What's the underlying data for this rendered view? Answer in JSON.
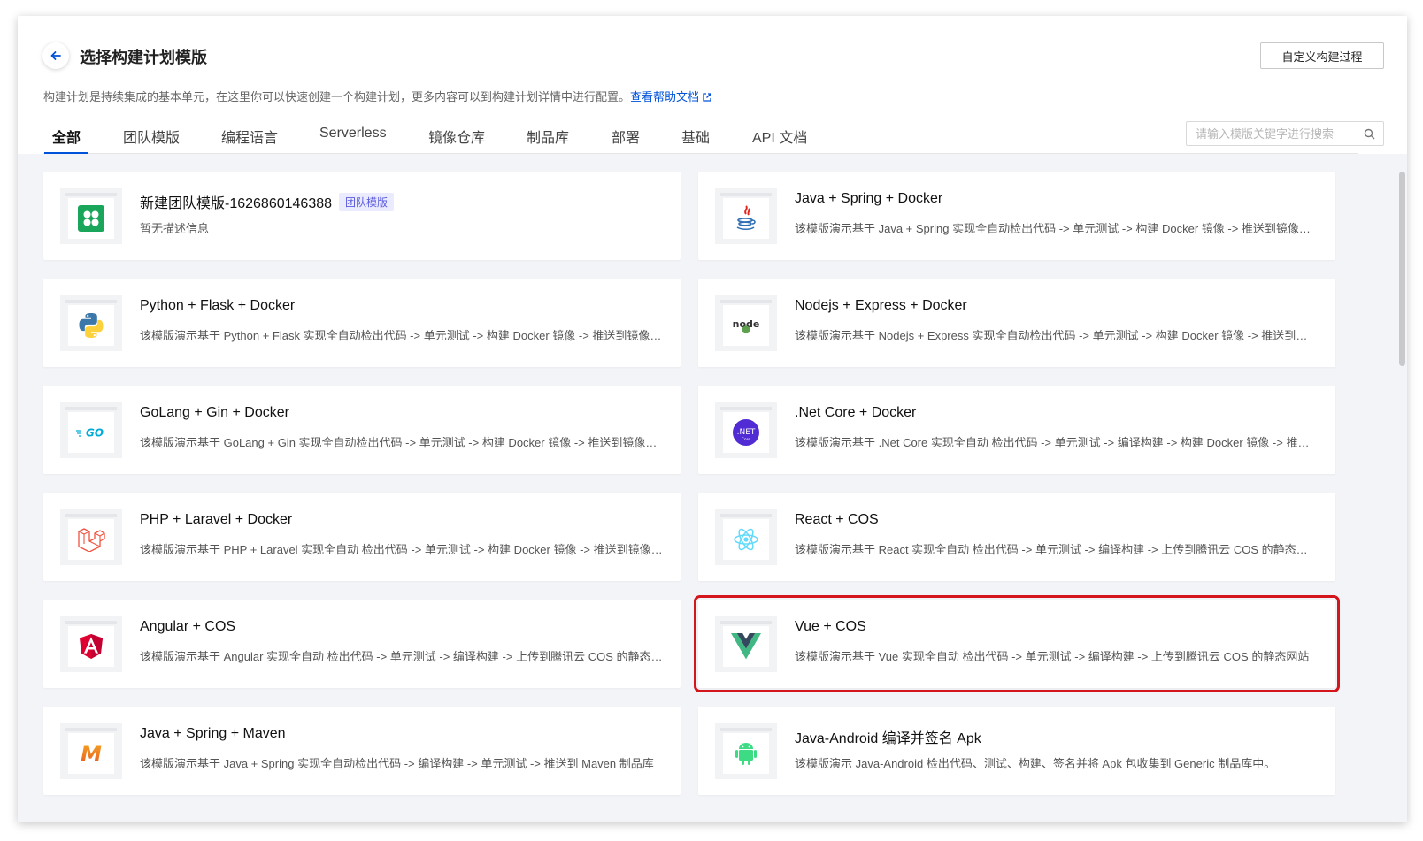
{
  "page": {
    "title": "选择构建计划模版",
    "custom_button": "自定义构建过程",
    "description": "构建计划是持续集成的基本单元，在这里你可以快速创建一个构建计划，更多内容可以到构建计划详情中进行配置。",
    "help_link": "查看帮助文档"
  },
  "tabs": [
    "全部",
    "团队模版",
    "编程语言",
    "Serverless",
    "镜像仓库",
    "制品库",
    "部署",
    "基础",
    "API 文档"
  ],
  "active_tab": "全部",
  "search": {
    "placeholder": "请输入模版关键字进行搜索",
    "value": ""
  },
  "cards": [
    {
      "title": "新建团队模版-1626860146388",
      "badge": "团队模版",
      "desc": "暂无描述信息",
      "icon": "team-template-icon"
    },
    {
      "title": "Java + Spring + Docker",
      "desc": "该模版演示基于 Java + Spring 实现全自动检出代码 -> 单元测试 -> 构建 Docker 镜像 -> 推送到镜像仓库",
      "icon": "java-icon"
    },
    {
      "title": "Python + Flask + Docker",
      "desc": "该模版演示基于 Python + Flask 实现全自动检出代码 -> 单元测试 -> 构建 Docker 镜像 -> 推送到镜像仓库",
      "icon": "python-icon"
    },
    {
      "title": "Nodejs + Express + Docker",
      "desc": "该模版演示基于 Nodejs + Express 实现全自动检出代码 -> 单元测试 -> 构建 Docker 镜像 -> 推送到镜像仓库",
      "icon": "nodejs-icon"
    },
    {
      "title": "GoLang + Gin + Docker",
      "desc": "该模版演示基于 GoLang + Gin 实现全自动检出代码 -> 单元测试 -> 构建 Docker 镜像 -> 推送到镜像仓库",
      "icon": "golang-icon"
    },
    {
      "title": ".Net Core + Docker",
      "desc": "该模版演示基于 .Net Core 实现全自动 检出代码 -> 单元测试 -> 编译构建 -> 构建 Docker 镜像 -> 推送到镜像仓库",
      "icon": "dotnet-icon"
    },
    {
      "title": "PHP + Laravel + Docker",
      "desc": "该模版演示基于 PHP + Laravel 实现全自动 检出代码 -> 单元测试 -> 构建 Docker 镜像 -> 推送到镜像仓库",
      "icon": "laravel-icon"
    },
    {
      "title": "React + COS",
      "desc": "该模版演示基于 React 实现全自动 检出代码 -> 单元测试 -> 编译构建 -> 上传到腾讯云 COS 的静态网站",
      "icon": "react-icon"
    },
    {
      "title": "Angular + COS",
      "desc": "该模版演示基于 Angular 实现全自动 检出代码 -> 单元测试 -> 编译构建 -> 上传到腾讯云 COS 的静态网站",
      "icon": "angular-icon"
    },
    {
      "title": "Vue + COS",
      "desc": "该模版演示基于 Vue 实现全自动 检出代码 -> 单元测试 -> 编译构建 -> 上传到腾讯云 COS 的静态网站",
      "icon": "vue-icon",
      "highlighted": true
    },
    {
      "title": "Java + Spring + Maven",
      "desc": "该模版演示基于 Java + Spring 实现全自动检出代码 -> 编译构建 -> 单元测试 -> 推送到 Maven 制品库",
      "icon": "maven-icon"
    },
    {
      "title": "Java-Android 编译并签名 Apk",
      "desc": "该模版演示 Java-Android 检出代码、测试、构建、签名并将 Apk 包收集到 Generic 制品库中。",
      "icon": "android-icon"
    }
  ],
  "colors": {
    "accent": "#0052d9",
    "highlight_border": "#d4151c",
    "content_background": "#f3f4f7",
    "badge_text": "#5b5cde",
    "badge_background": "#ebebff"
  }
}
